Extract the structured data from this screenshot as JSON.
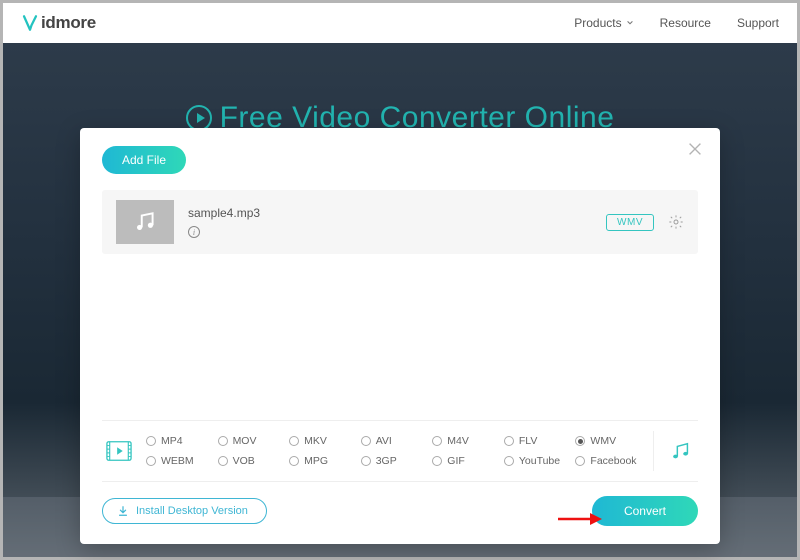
{
  "nav": {
    "brand_text": "idmore",
    "links": {
      "products": "Products",
      "resource": "Resource",
      "support": "Support"
    }
  },
  "hero": {
    "title": "Free Video Converter Online"
  },
  "modal": {
    "add_file_label": "Add File",
    "file": {
      "name": "sample4.mp3",
      "badge": "WMV"
    },
    "formats_row1": [
      "MP4",
      "MOV",
      "MKV",
      "AVI",
      "M4V",
      "FLV",
      "WMV"
    ],
    "formats_row2": [
      "WEBM",
      "VOB",
      "MPG",
      "3GP",
      "GIF",
      "YouTube",
      "Facebook"
    ],
    "selected_format": "WMV",
    "install_label": "Install Desktop Version",
    "convert_label": "Convert"
  }
}
